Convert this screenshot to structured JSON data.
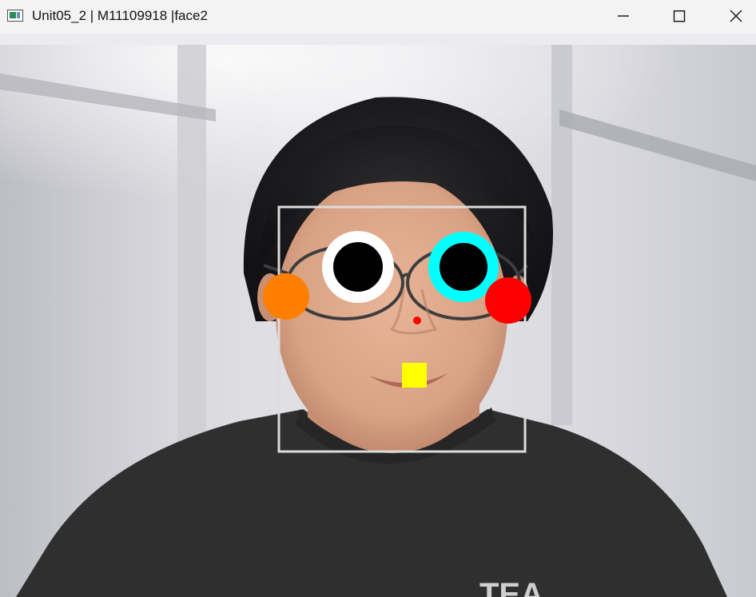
{
  "window": {
    "title": "Unit05_2 | M11109918 |face2",
    "icon": "opencv-window-icon",
    "controls": [
      "minimize-icon",
      "maximize-icon",
      "close-icon"
    ]
  },
  "overlay": {
    "shirt_text": "TEA",
    "colors": {
      "face_box": "#dcdcdc",
      "left_eye_ring": "#ffffff",
      "right_eye_ring": "#00ffff",
      "pupil": "#000000",
      "left_cheek": "#ff7f00",
      "right_cheek": "#ff0000",
      "nose": "#ff0000",
      "mouth": "#ffff00"
    }
  }
}
